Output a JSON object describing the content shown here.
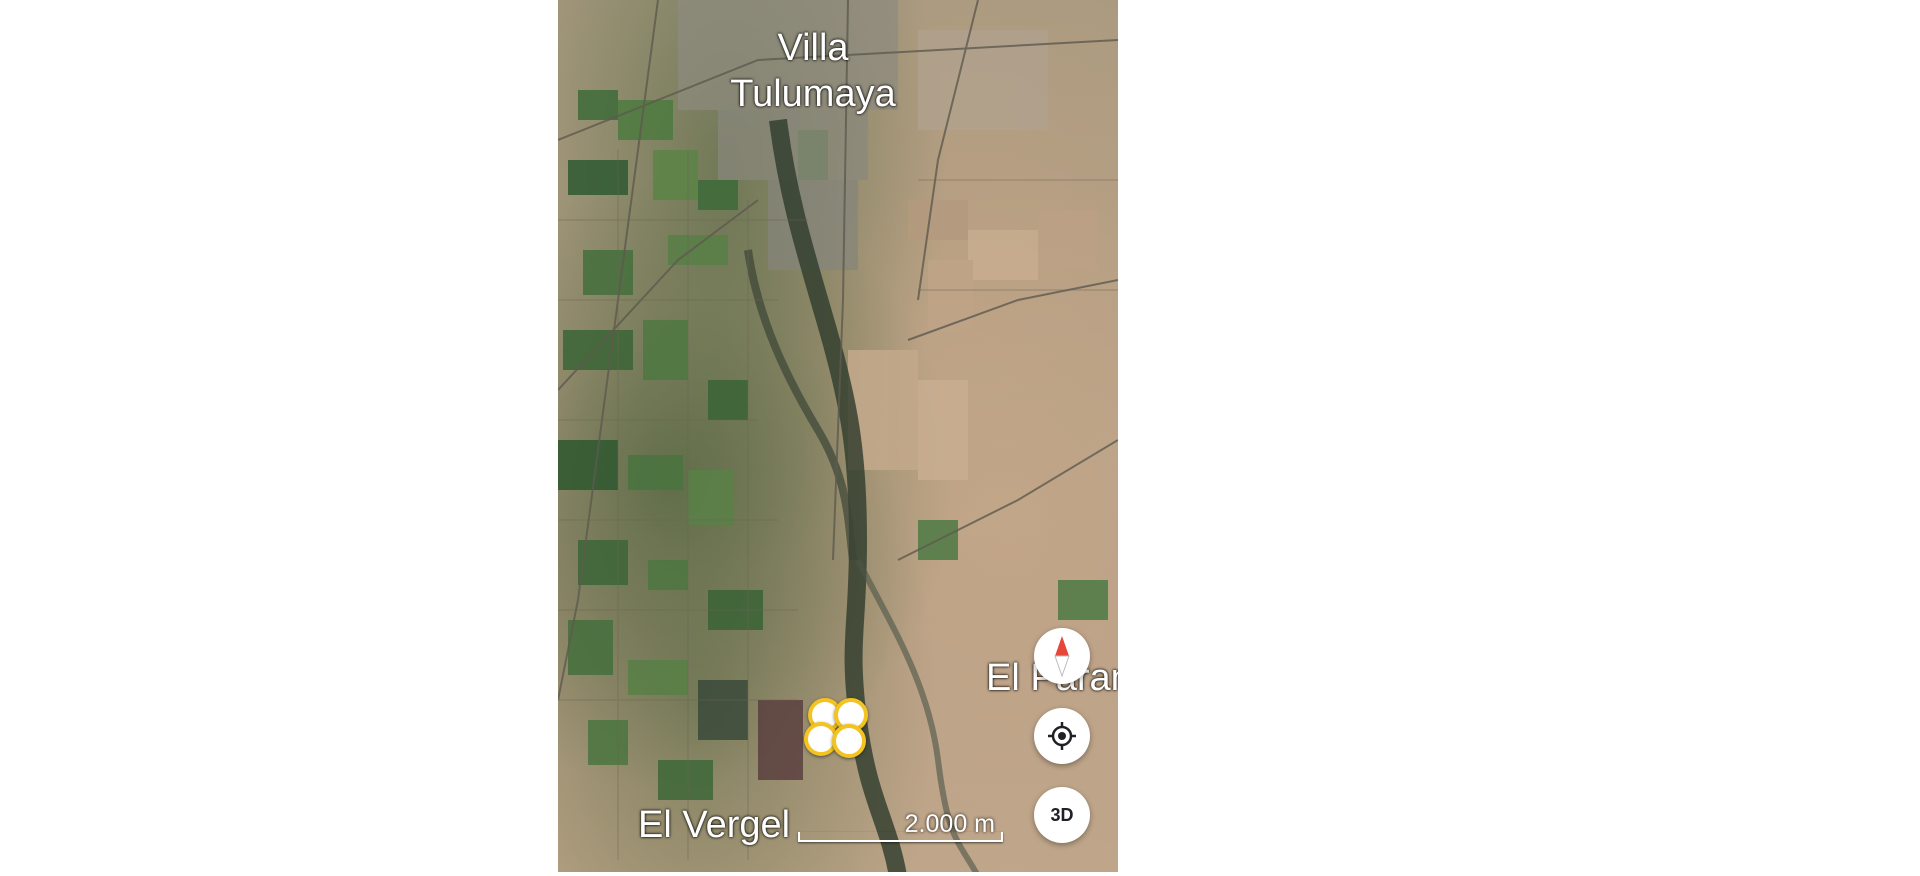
{
  "map": {
    "view": "satellite",
    "places": {
      "villa_tulumaya": "Villa\nTulumaya",
      "el_vergel": "El Vergel",
      "el_paran": "El Paran"
    },
    "scale_label": "2.000 m",
    "marker_count": 4,
    "marker_color": "#f2c321"
  },
  "controls": {
    "compass_icon": "compass-icon",
    "locate_icon": "my-location-icon",
    "three_d_label": "3D"
  }
}
